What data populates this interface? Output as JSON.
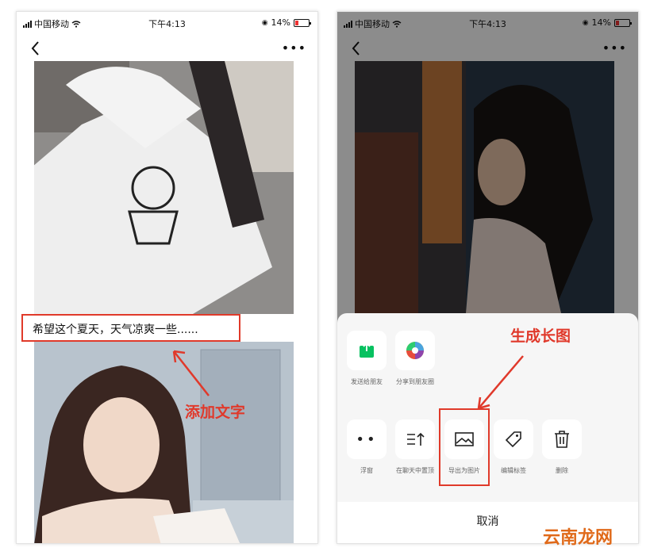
{
  "left": {
    "status": {
      "carrier": "中国移动",
      "time": "下午4:13",
      "battery": "14%"
    },
    "caption": "希望这个夏天，天气凉爽一些......",
    "annotation": "添加文字"
  },
  "right": {
    "status": {
      "carrier": "中国移动",
      "time": "下午4:13",
      "battery": "14%"
    },
    "annotation": "生成长图",
    "share_row": [
      {
        "label": "发送给朋友",
        "icon": "send-to-friend-icon"
      },
      {
        "label": "分享到朋友圈",
        "icon": "moments-icon"
      }
    ],
    "action_row": [
      {
        "label": "浮窗",
        "icon": "float-window-icon"
      },
      {
        "label": "在聊天中置顶",
        "icon": "pin-top-icon"
      },
      {
        "label": "导出为图片",
        "icon": "image-export-icon"
      },
      {
        "label": "编辑标签",
        "icon": "tag-icon"
      },
      {
        "label": "删除",
        "icon": "trash-icon"
      }
    ],
    "cancel": "取消"
  },
  "watermark": "云南龙网",
  "colors": {
    "annotation": "#e0392b",
    "highlight": "#e03a2a",
    "wechat_green": "#07c160",
    "watermark": "#e06a1a"
  }
}
